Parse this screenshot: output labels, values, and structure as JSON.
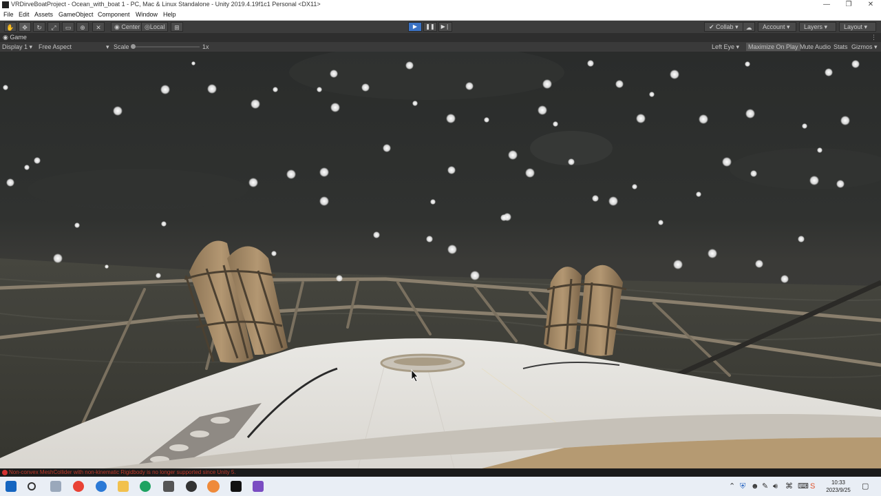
{
  "window": {
    "title": "VRDirveBoatProject - Ocean_with_boat 1 - PC, Mac & Linux Standalone - Unity 2019.4.19f1c1 Personal <DX11>",
    "minimize": "—",
    "maximize": "❐",
    "close": "✕"
  },
  "menu": {
    "items": [
      "File",
      "Edit",
      "Assets",
      "GameObject",
      "Component",
      "Window",
      "Help"
    ]
  },
  "toolbar": {
    "pivot_center": "Center",
    "pivot_local": "Local",
    "collab": "Collab",
    "account": "Account",
    "layers": "Layers",
    "layout": "Layout",
    "play_icon": "play-icon",
    "pause_icon": "pause-icon",
    "step_icon": "step-icon"
  },
  "game_tab": {
    "label": "Game",
    "display": "Display 1",
    "aspect": "Free Aspect",
    "scale_label": "Scale",
    "scale_value": "1x",
    "scale_level": 0.0,
    "eye": "Left Eye",
    "maximize_on_play": "Maximize On Play",
    "mute_audio": "Mute Audio",
    "stats": "Stats",
    "gizmos": "Gizmos"
  },
  "console": {
    "message": "Non-convex MeshCollider with non-kinematic Rigidbody is no longer supported since Unity 5."
  },
  "taskbar": {
    "time": "10:33",
    "date": "2023/9/25"
  },
  "colors": {
    "play_active": "#3a72c4",
    "error": "#d43232",
    "sky": "#2e302f",
    "sea": "#3d3d39",
    "deck": "#e8e6e2",
    "fender": "#a68b67"
  }
}
